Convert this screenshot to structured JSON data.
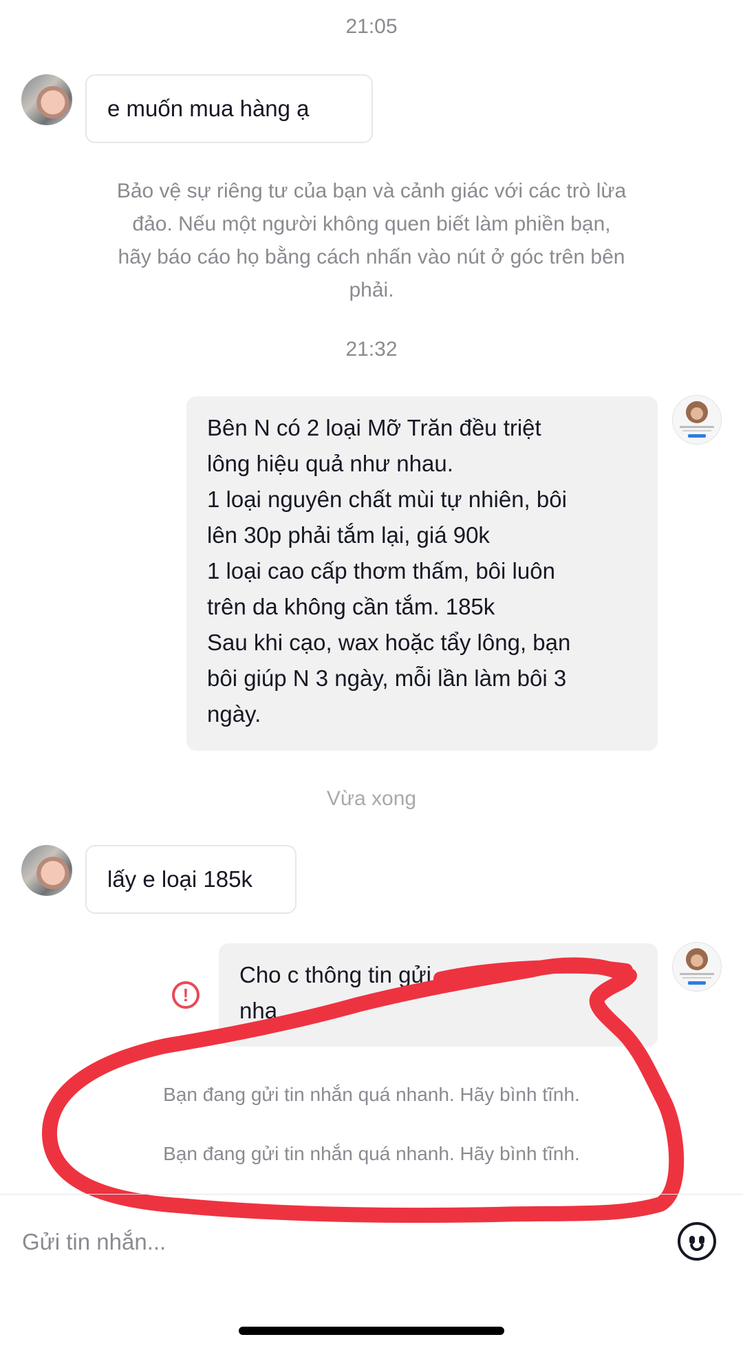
{
  "timestamps": {
    "t1": "21:05",
    "t2": "21:32",
    "t3": "Vừa xong"
  },
  "messages": {
    "m1": "e muốn mua hàng ạ",
    "m2_lines": [
      "Bên N có 2 loại Mỡ Trăn đều triệt",
      "lông hiệu quả như nhau.",
      "1 loại nguyên chất mùi tự nhiên, bôi",
      "lên 30p phải tắm lại, giá 90k",
      "1 loại cao cấp thơm thấm, bôi luôn",
      "trên da không cần tắm. 185k",
      "Sau khi cạo, wax hoặc tẩy lông, bạn",
      "bôi giúp N 3 ngày, mỗi lần làm bôi 3",
      "ngày."
    ],
    "m3": "lấy e loại 185k",
    "m4_line1": "Cho c thông tin gửi",
    "m4_line2": "nha"
  },
  "privacy_notice": [
    "Bảo vệ sự riêng tư của bạn và cảnh giác với các trò lừa",
    "đảo. Nếu một người không quen biết làm phiền bạn,",
    "hãy báo cáo họ bằng cách nhấn vào nút ở góc trên bên",
    "phải."
  ],
  "warnings": [
    "Bạn đang gửi tin nhắn quá nhanh. Hãy bình tĩnh.",
    "Bạn đang gửi tin nhắn quá nhanh. Hãy bình tĩnh."
  ],
  "input": {
    "placeholder": "Gửi tin nhắn..."
  },
  "icons": {
    "error": "alert-circle-icon",
    "emoji": "smiley-face-icon"
  },
  "colors": {
    "annotation_red": "#ee3340",
    "error_red": "#e94a57",
    "muted_text": "#8a8b91"
  }
}
